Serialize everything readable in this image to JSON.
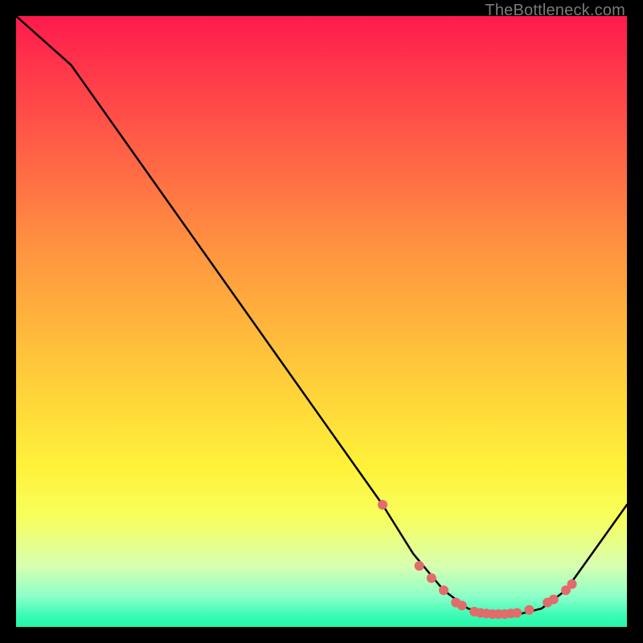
{
  "watermark": "TheBottleneck.com",
  "chart_data": {
    "type": "line",
    "title": "",
    "xlabel": "",
    "ylabel": "",
    "xlim": [
      0,
      100
    ],
    "ylim": [
      0,
      100
    ],
    "curve": {
      "x": [
        0,
        9,
        60,
        65,
        70,
        74,
        78,
        82,
        86,
        90,
        100
      ],
      "y": [
        100,
        92,
        20,
        12,
        6,
        3,
        2,
        2,
        3,
        6,
        20
      ]
    },
    "markers": {
      "x": [
        60,
        66,
        68,
        70,
        72,
        73,
        75,
        76,
        77,
        78,
        79,
        80,
        81,
        82,
        84,
        87,
        88,
        90,
        91
      ],
      "y": [
        20,
        10,
        8,
        6,
        4,
        3.5,
        2.5,
        2.3,
        2.2,
        2.1,
        2.1,
        2.1,
        2.2,
        2.3,
        2.8,
        4,
        4.5,
        6,
        7
      ],
      "color": "#e26b6b",
      "radius": 6
    }
  }
}
